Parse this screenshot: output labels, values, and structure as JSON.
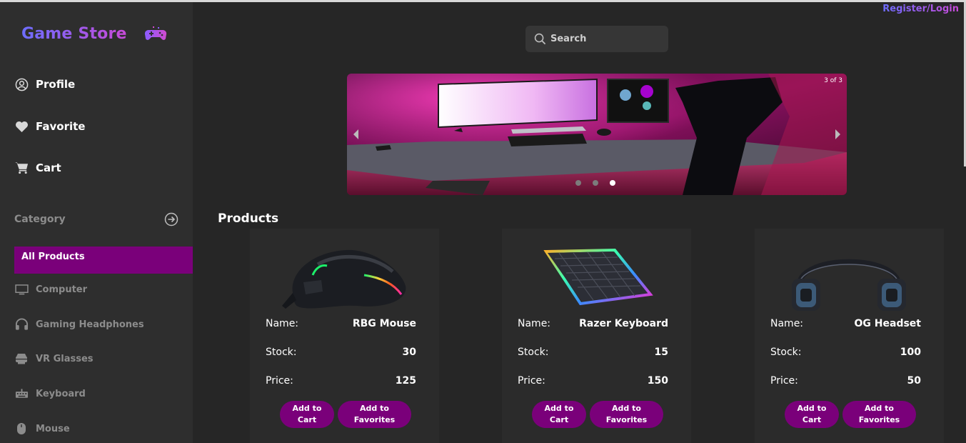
{
  "app": {
    "brand": "Game Store",
    "brand_gradient": [
      "#6d6dff",
      "#c84ad8"
    ],
    "accent": "#7a007a"
  },
  "header": {
    "auth_link": "Register/Login",
    "search": {
      "placeholder": "Search",
      "icon": "search-icon"
    }
  },
  "sidebar": {
    "nav": [
      {
        "label": "Profile",
        "icon": "user-circle-icon"
      },
      {
        "label": "Favorite",
        "icon": "heart-icon"
      },
      {
        "label": "Cart",
        "icon": "cart-icon"
      }
    ],
    "category_heading": "Category",
    "category_icon": "arrow-right-circle-icon",
    "active_category": "All Products",
    "categories": [
      {
        "label": "Computer",
        "icon": "monitor-icon"
      },
      {
        "label": "Gaming Headphones",
        "icon": "headphones-icon"
      },
      {
        "label": "VR Glasses",
        "icon": "vr-headset-icon"
      },
      {
        "label": "Keyboard",
        "icon": "keyboard-icon"
      },
      {
        "label": "Mouse",
        "icon": "mouse-icon"
      }
    ]
  },
  "carousel": {
    "counter": "3 of 3",
    "current": 3,
    "total": 3
  },
  "products_section": {
    "title": "Products",
    "field_labels": {
      "name": "Name:",
      "stock": "Stock:",
      "price": "Price:"
    },
    "add_to_cart_label": "Add to\nCart",
    "add_to_favorites_label": "Add to\nFavorites",
    "items": [
      {
        "name": "RBG Mouse",
        "stock": "30",
        "price": "125",
        "image": "gaming-mouse"
      },
      {
        "name": "Razer Keyboard",
        "stock": "15",
        "price": "150",
        "image": "rgb-keyboard"
      },
      {
        "name": "OG Headset",
        "stock": "100",
        "price": "50",
        "image": "headset"
      }
    ]
  }
}
